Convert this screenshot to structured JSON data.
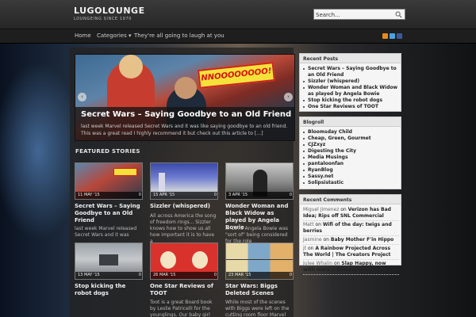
{
  "header": {
    "site_title": "LUGOLOUNGE",
    "tagline": "LOUNGEING SINCE 1970",
    "search_value": "Search..."
  },
  "nav": {
    "items": [
      "Home",
      "Categories ▾",
      "They're all going to laugh at you"
    ],
    "social_icons": [
      {
        "name": "rss-icon",
        "color": "#e8891d"
      },
      {
        "name": "twitter-icon",
        "color": "#4aa3df"
      },
      {
        "name": "facebook-icon",
        "color": "#3b5998"
      }
    ]
  },
  "slider": {
    "sound_effect": "NNOOOOOOOO!",
    "title": "Secret Wars – Saying Goodbye to an Old Friend",
    "text": "last week Marvel released Secret Wars and it was like saying goodbye to an old friend. This was a great read I highly recommend it but check out this article to […]",
    "prev": "‹",
    "next": "›"
  },
  "featured": {
    "heading": "FEATURED STORIES",
    "cards": [
      {
        "date": "11 MAY '15",
        "comments": "0",
        "title": "Secret Wars – Saying Goodbye to an Old Friend",
        "excerpt": "last week Marvel released Secret Wars and it was"
      },
      {
        "date": "15 APR '15",
        "comments": "0",
        "title": "Sizzler (whispered)",
        "excerpt": "All across America the song of freedom rings... Sizzler knows how to show us all how important it is to have a"
      },
      {
        "date": "3 APR '15",
        "comments": "0",
        "title": "Wonder Woman and Black Widow as played by Angela Bowie",
        "excerpt": "In 1973 Angela Bowie was \"sort of\" being considered for the role"
      },
      {
        "date": "13 MAY '15",
        "comments": "0",
        "title": "Stop kicking the robot dogs",
        "excerpt": ""
      },
      {
        "date": "26 MAR '15",
        "comments": "0",
        "title": "One Star Reviews of TOOT",
        "excerpt": "Toot is a great Board book by Leslie Patricelli for the younglings. Our baby girl love it"
      },
      {
        "date": "23 MAR '15",
        "comments": "0",
        "title": "Star Wars: Biggs Deleted Scenes",
        "excerpt": "While most of the scenes with Biggs were left on the cutting room floor Marvel still kept"
      }
    ]
  },
  "sidebar": {
    "recent_posts": {
      "title": "Recent Posts",
      "items": [
        "Secret Wars – Saying Goodbye to an Old Friend",
        "Sizzler (whispered)",
        "Wonder Woman and Black Widow as played by Angela Bowie",
        "Stop kicking the robot dogs",
        "One Star Reviews of TOOT"
      ]
    },
    "blogroll": {
      "title": "Blogroll",
      "items": [
        "Bloomsday Child",
        "Cheap, Green, Gourmet",
        "CJZxyz",
        "Digesting the City",
        "Media Musings",
        "pantaloonfan",
        "RyanBlog",
        "Sassy.net",
        "Solipsistastic"
      ]
    },
    "recent_comments": {
      "title": "Recent Comments",
      "items": [
        {
          "author": "Miguel Jimenez",
          "on": " on ",
          "post": "Verizon has Bad Idea; Rips off SNL Commercial"
        },
        {
          "author": "Matt",
          "on": " on ",
          "post": "Wifi of the day: twigs and berries"
        },
        {
          "author": "Jasmine",
          "on": " on ",
          "post": "Baby Mother F'in Hippo"
        },
        {
          "author": "jt",
          "on": " on ",
          "post": "A Rainbow Projected Across The World | The Creators Project"
        },
        {
          "author": "Julee Whalin",
          "on": " on ",
          "post": "Slap Happy, now with more… Atmosphere"
        }
      ]
    }
  }
}
